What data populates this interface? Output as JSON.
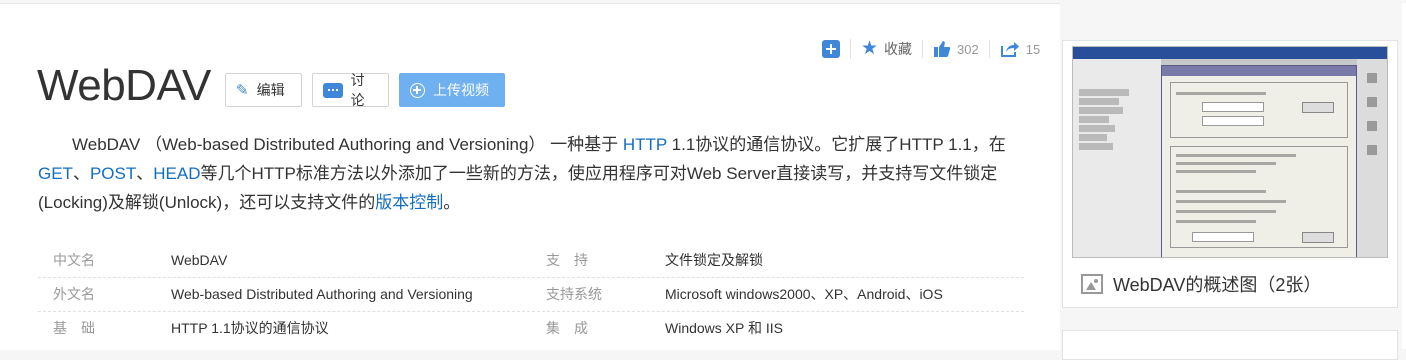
{
  "title": "WebDAV",
  "actions": {
    "edit": "编辑",
    "discuss": "讨论",
    "upload": "上传视频"
  },
  "tools": {
    "favorite": "收藏",
    "like_count": "302",
    "share_count": "15"
  },
  "summary": {
    "parts": [
      "WebDAV （Web-based Distributed Authoring and Versioning） 一种基于 ",
      "HTTP",
      " 1.1协议的通信协议。它扩展了HTTP 1.1，在",
      "GET",
      "、",
      "POST",
      "、",
      "HEAD",
      "等几个HTTP标准方法以外添加了一些新的方法，使应用程序可对Web Server直接读写，并支持写文件锁定(Locking)及解锁(Unlock)，还可以支持文件的",
      "版本控制",
      "。"
    ]
  },
  "info": [
    {
      "label1": "中文名",
      "value1": "WebDAV",
      "label2": "支　持",
      "value2": "文件锁定及解锁"
    },
    {
      "label1": "外文名",
      "value1": "Web-based Distributed Authoring and Versioning",
      "label2": "支持系统",
      "value2": "Microsoft windows2000、XP、Android、iOS"
    },
    {
      "label1": "基　础",
      "value1": "HTTP 1.1协议的通信协议",
      "label2": "集　成",
      "value2": "Windows XP 和 IIS"
    }
  ],
  "album": {
    "caption": "WebDAV的概述图（2张）"
  },
  "colors": {
    "link": "#136ec2",
    "accent": "#3f87d8",
    "upload_button": "#6fb0f0"
  },
  "icons": [
    "add-icon",
    "star-icon",
    "thumb-up-icon",
    "share-icon",
    "pencil-icon",
    "comment-icon",
    "plus-circle-icon",
    "picture-icon"
  ]
}
